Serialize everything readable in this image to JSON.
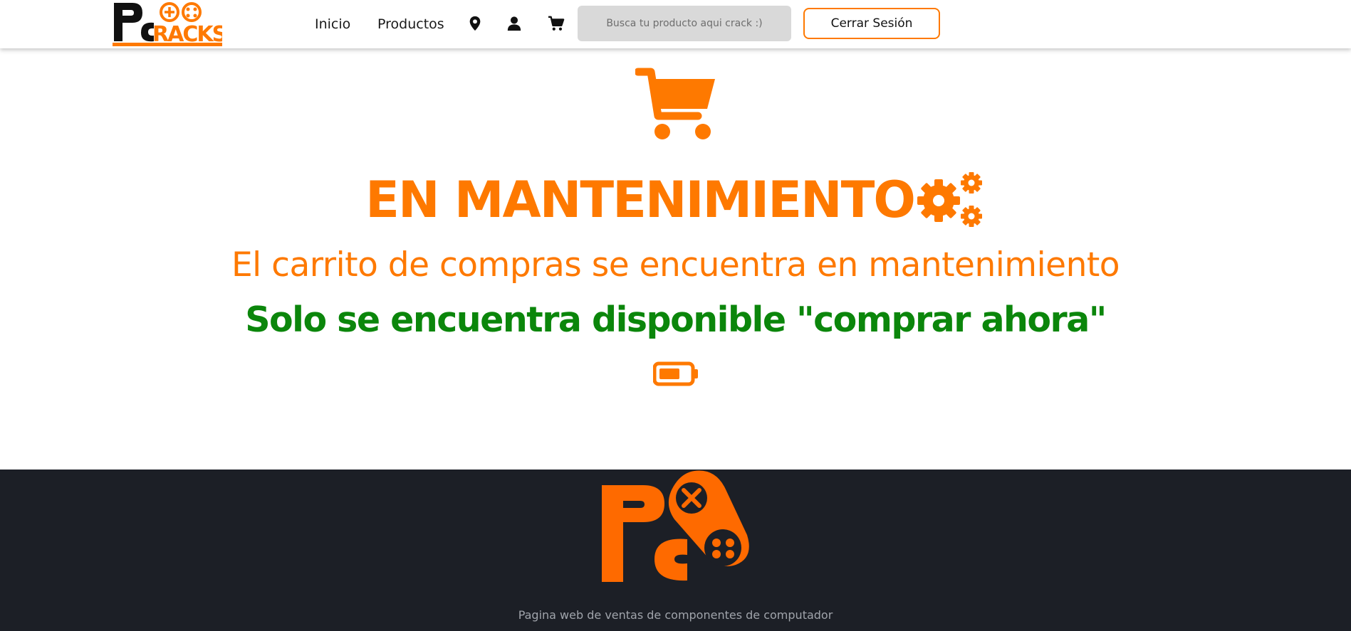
{
  "header": {
    "logo_text": "PCRACKS",
    "nav": {
      "home": "Inicio",
      "products": "Productos"
    },
    "icons": [
      "location-icon",
      "user-icon",
      "cart-icon"
    ],
    "search_placeholder": "Busca tu producto aqui crack :)",
    "logout_label": "Cerrar Sesión"
  },
  "main": {
    "title": "EN MANTENIMIENTO",
    "subtitle": "El carrito de compras se encuentra en mantenimiento",
    "notice": "Solo se encuentra disponible \"comprar ahora\"",
    "icons": [
      "shopping-cart-icon",
      "gears-icon",
      "battery-low-icon"
    ]
  },
  "footer": {
    "logo_text": "PC",
    "description": "Pagina web de ventas de componentes de computador"
  },
  "colors": {
    "accent": "#fe7900",
    "green": "#0b860b",
    "footer_bg": "#1c1f26",
    "footer_text": "#a0a4ab"
  }
}
